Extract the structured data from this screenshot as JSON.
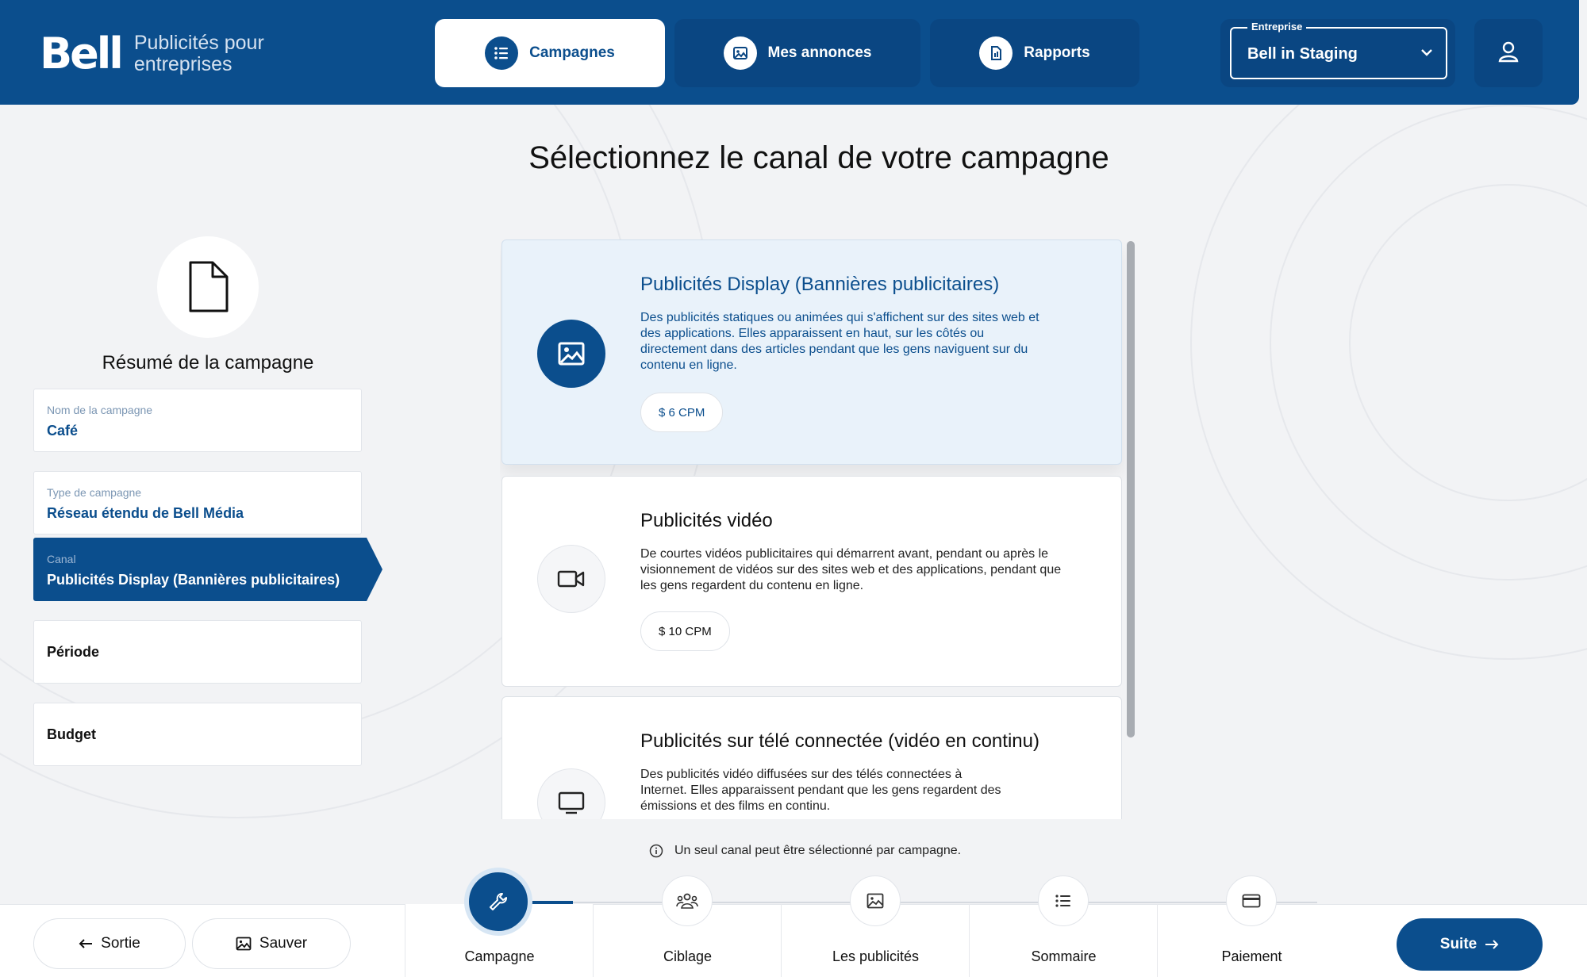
{
  "brand": {
    "name": "Bell",
    "subtitle": "Publicités pour entreprises"
  },
  "nav": {
    "tabs": [
      {
        "label": "Campagnes",
        "icon": "list-icon",
        "active": true
      },
      {
        "label": "Mes annonces",
        "icon": "image-icon",
        "active": false
      },
      {
        "label": "Rapports",
        "icon": "report-icon",
        "active": false
      }
    ],
    "entreprise": {
      "legend": "Entreprise",
      "value": "Bell in Staging"
    }
  },
  "summary": {
    "title": "Résumé de la campagne",
    "fields": [
      {
        "label": "Nom de la campagne",
        "value": "Café"
      },
      {
        "label": "Type de campagne",
        "value": "Réseau étendu de Bell Média"
      },
      {
        "label": "Canal",
        "value": "Publicités Display (Bannières publicitaires)"
      },
      {
        "label": "",
        "value": "Période"
      },
      {
        "label": "",
        "value": "Budget"
      }
    ]
  },
  "main": {
    "title": "Sélectionnez le canal de votre campagne",
    "channels": [
      {
        "title": "Publicités Display (Bannières publicitaires)",
        "description": "Des publicités statiques ou animées qui s'affichent sur des sites web et des applications. Elles apparaissent en haut, sur les côtés ou directement dans des articles pendant que les gens naviguent sur du contenu en ligne.",
        "price": "$ 6 CPM",
        "selected": true
      },
      {
        "title": "Publicités vidéo",
        "description": "De courtes vidéos publicitaires qui démarrent avant, pendant ou après le visionnement de vidéos sur des sites web et des applications, pendant que les gens regardent du contenu en ligne.",
        "price": "$ 10 CPM",
        "selected": false
      },
      {
        "title": "Publicités sur télé connectée (vidéo en continu)",
        "description": "Des publicités vidéo diffusées sur des télés connectées à Internet. Elles apparaissent pendant que les gens regardent des émissions et des films en continu.",
        "price": "",
        "selected": false
      }
    ],
    "note": "Un seul canal peut être sélectionné par campagne."
  },
  "footer": {
    "exit_label": "Sortie",
    "save_label": "Sauver",
    "next_label": "Suite",
    "steps": [
      {
        "label": "Campagne",
        "icon": "wrench-icon",
        "active": true
      },
      {
        "label": "Ciblage",
        "icon": "audience-icon",
        "active": false
      },
      {
        "label": "Les publicités",
        "icon": "image-icon",
        "active": false
      },
      {
        "label": "Sommaire",
        "icon": "list-icon",
        "active": false
      },
      {
        "label": "Paiement",
        "icon": "card-icon",
        "active": false
      }
    ]
  },
  "colors": {
    "primary": "#0b4e8d",
    "selected_card": "#e9f2fa",
    "background": "#f2f3f5"
  }
}
